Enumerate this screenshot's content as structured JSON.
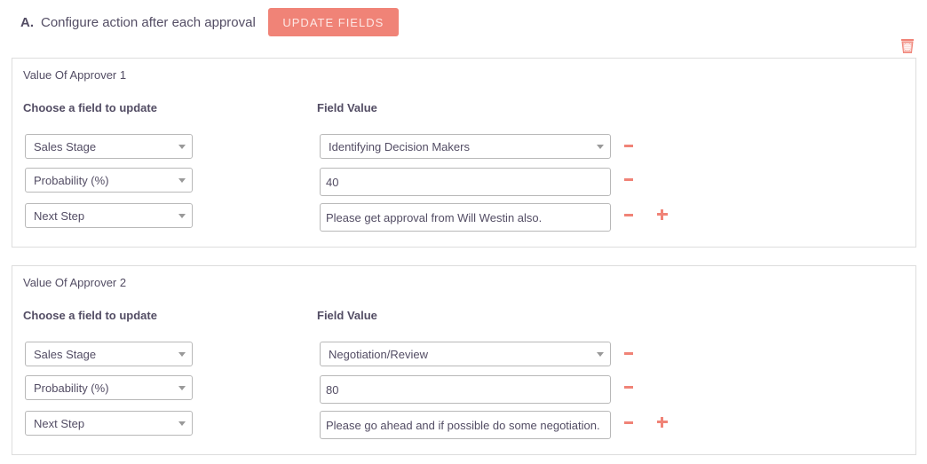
{
  "header": {
    "letter": "A.",
    "title": "Configure action after each approval",
    "update_button": "UPDATE FIELDS"
  },
  "icons": {
    "trash": "trash-icon",
    "remove": "minus-icon",
    "add": "plus-icon",
    "dropdown": "caret-down-icon"
  },
  "colors": {
    "accent": "#f08377",
    "text": "#534d64",
    "border": "#dddddd"
  },
  "panels": [
    {
      "title": "Value Of Approver 1",
      "col_field": "Choose a field to update",
      "col_value": "Field Value",
      "rows": [
        {
          "field": "Sales Stage",
          "value": "Identifying Decision Makers",
          "value_type": "select"
        },
        {
          "field": "Probability (%)",
          "value": "40",
          "value_type": "input"
        },
        {
          "field": "Next Step",
          "value": "Please get approval from Will Westin also.",
          "value_type": "input"
        }
      ]
    },
    {
      "title": "Value Of Approver 2",
      "col_field": "Choose a field to update",
      "col_value": "Field Value",
      "rows": [
        {
          "field": "Sales Stage",
          "value": "Negotiation/Review",
          "value_type": "select"
        },
        {
          "field": "Probability (%)",
          "value": "80",
          "value_type": "input"
        },
        {
          "field": "Next Step",
          "value": "Please go ahead and if possible do some negotiation.",
          "value_type": "input"
        }
      ]
    }
  ]
}
